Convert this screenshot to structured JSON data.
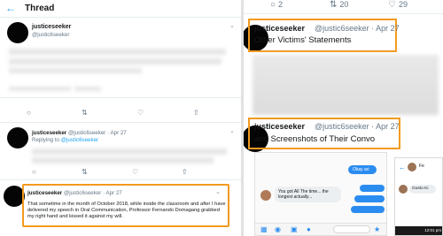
{
  "left_panel": {
    "header": {
      "back_icon": "back-arrow-icon",
      "title": "Thread"
    },
    "tweet1": {
      "username": "justiceseeker",
      "handle": "@justic6seeker"
    },
    "tweet2": {
      "username": "justiceseeker",
      "handle_date": "@justic6seeker · Apr 27",
      "replying_prefix": "Replying to ",
      "replying_handle": "@justic6seeker"
    },
    "tweet3": {
      "username": "justiceseeker",
      "handle_date": "@justic6seeker · Apr 27",
      "text": "That sometime in the month of October 2018, while inside the classroom and after I have delivered my speech in Oral Communication, Professor Fernando Domagang grabbed my right hand and kissed it against my will."
    },
    "action_icons": [
      "reply-icon",
      "retweet-icon",
      "like-icon",
      "share-icon"
    ]
  },
  "right_panel": {
    "top_actions": [
      {
        "icon": "reply-icon",
        "count": "2"
      },
      {
        "icon": "retweet-icon",
        "count": "20"
      },
      {
        "icon": "like-icon",
        "count": "29"
      }
    ],
    "tweet_a": {
      "username": "justiceseeker",
      "handle_date": "@justic6seeker · Apr 27",
      "text": "Other Victims' Statements"
    },
    "tweet_b": {
      "username": "justiceseeker",
      "handle_date": "@justic6seeker · Apr 27",
      "text": "and Screenshots of Their Convo"
    },
    "messenger": {
      "okay_text": "Okay ari",
      "got_text": "You got All The time... the longest actually...",
      "phone_name": "Fe",
      "phone_msg": "Gusto Ki",
      "phone_time": "12:01 pm"
    }
  },
  "colors": {
    "highlight": "#f29a1f",
    "accent": "#1da1f2",
    "messenger_blue": "#2b8cf0"
  }
}
